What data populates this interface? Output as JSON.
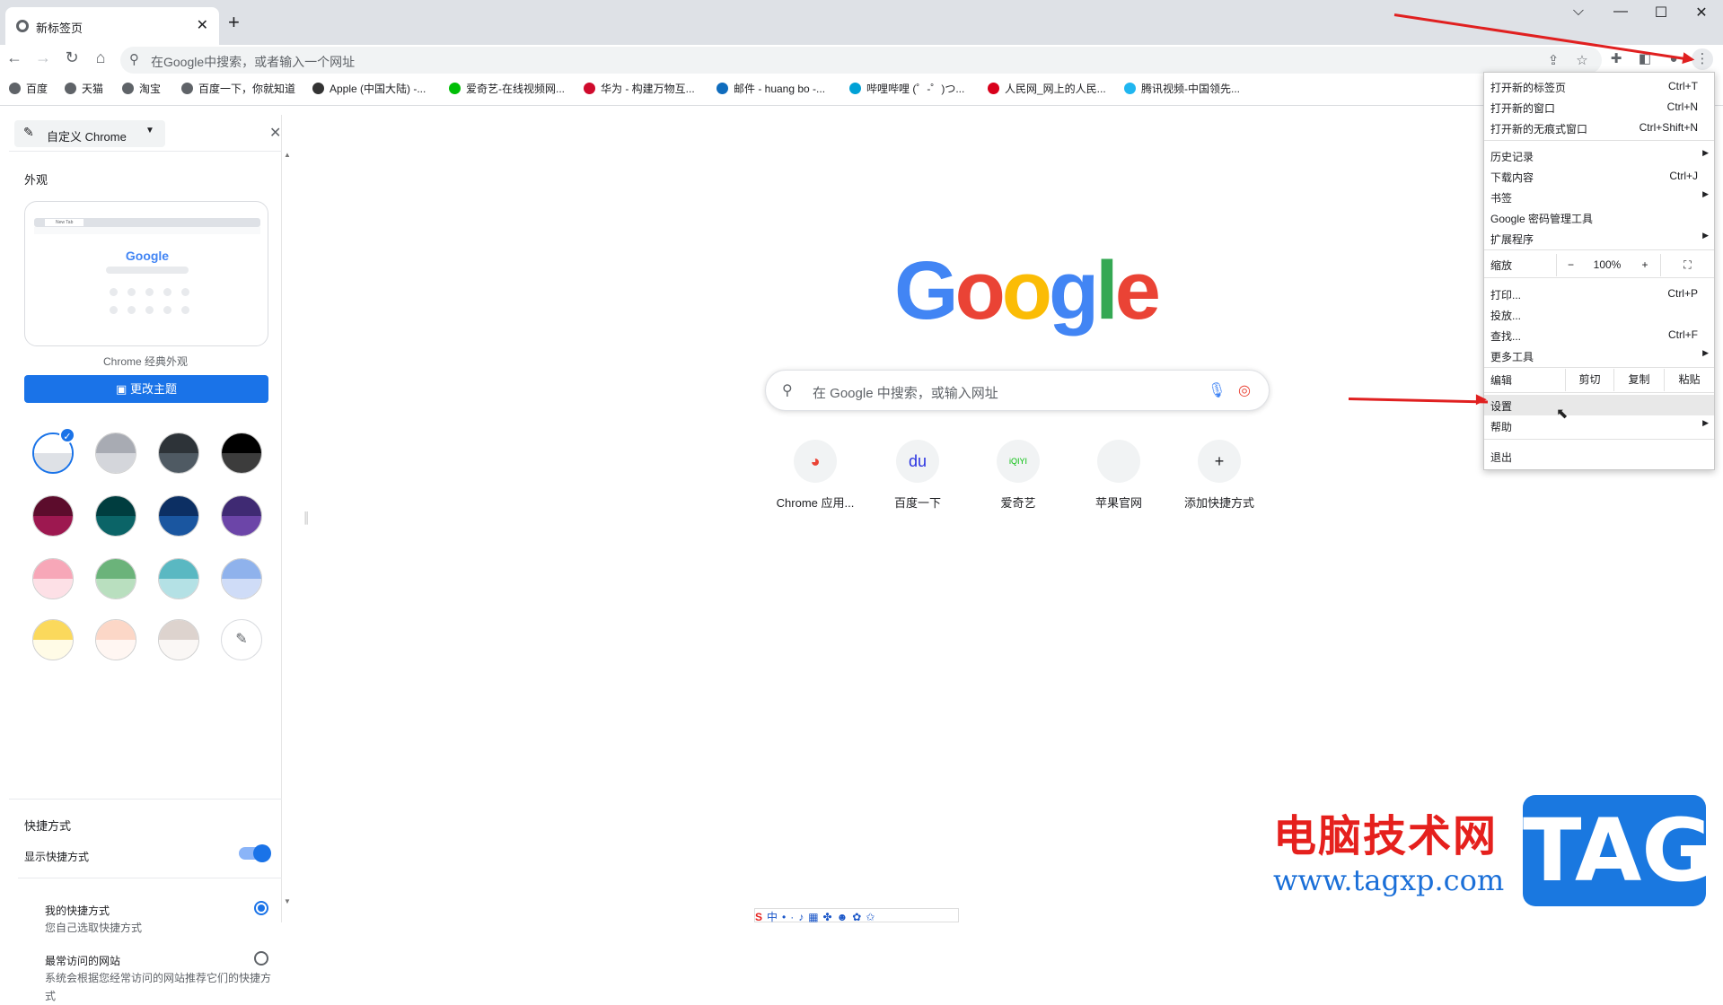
{
  "tab": {
    "title": "新标签页",
    "close": "✕",
    "new": "+"
  },
  "window": {
    "chevron": "⌵",
    "minimize": "—",
    "maximize": "☐",
    "close": "✕"
  },
  "nav": {
    "back": "←",
    "forward": "→",
    "reload": "↻",
    "home": "⌂"
  },
  "omnibox": {
    "placeholder": "在Google中搜索，或者输入一个网址",
    "search_icon": "search-icon"
  },
  "bookmarks": [
    {
      "label": "百度",
      "color": "#5f6368"
    },
    {
      "label": "天猫",
      "color": "#5f6368"
    },
    {
      "label": "淘宝",
      "color": "#5f6368"
    },
    {
      "label": "百度一下，你就知道",
      "color": "#5f6368"
    },
    {
      "label": "Apple (中国大陆) -...",
      "color": "#333333"
    },
    {
      "label": "爱奇艺-在线视频网...",
      "color": "#00be06"
    },
    {
      "label": "华为 - 构建万物互...",
      "color": "#cf0a2c"
    },
    {
      "label": "邮件 - huang bo -...",
      "color": "#0f6cbd"
    },
    {
      "label": "哔哩哔哩 (゜-゜)つ...",
      "color": "#00a1d6"
    },
    {
      "label": "人民网_网上的人民...",
      "color": "#d8001b"
    },
    {
      "label": "腾讯视频-中国领先...",
      "color": "#20b6f0"
    }
  ],
  "panel": {
    "header": "自定义 Chrome",
    "appearance": "外观",
    "preview_logo": "Google",
    "preview_tab": "New Tab",
    "preview_caption": "Chrome 经典外观",
    "change_theme": "更改主题",
    "shortcuts_title": "快捷方式",
    "show_shortcuts": "显示快捷方式",
    "show_shortcuts_on": true,
    "my_shortcuts": "我的快捷方式",
    "my_shortcuts_desc": "您自己选取快捷方式",
    "most_visited": "最常访问的网站",
    "most_visited_desc": "系统会根据您经常访问的网站推荐它们的快捷方式",
    "selected_option": "my_shortcuts"
  },
  "swatches": [
    {
      "top": "#ffffff",
      "bottom": "#dee1e6",
      "selected": true
    },
    {
      "top": "#a8abb3",
      "bottom": "#d4d6db"
    },
    {
      "top": "#2d3338",
      "bottom": "#4f5a63"
    },
    {
      "top": "#000000",
      "bottom": "#3c3c3c"
    },
    {
      "top": "#5c0c2c",
      "bottom": "#9d1850"
    },
    {
      "top": "#003d3f",
      "bottom": "#0b6467"
    },
    {
      "top": "#0c2f63",
      "bottom": "#1a56a0"
    },
    {
      "top": "#3f2a73",
      "bottom": "#6c45a8"
    },
    {
      "top": "#f7a7b8",
      "bottom": "#fde0e6"
    },
    {
      "top": "#6bb37a",
      "bottom": "#b9dfbf"
    },
    {
      "top": "#5ab8c2",
      "bottom": "#b4e1e5"
    },
    {
      "top": "#8fb2ec",
      "bottom": "#cfdcf7"
    },
    {
      "top": "#fbd95c",
      "bottom": "#fffbe6"
    },
    {
      "top": "#fcd7c7",
      "bottom": "#fff6f2"
    },
    {
      "top": "#ddd3ce",
      "bottom": "#faf7f5"
    }
  ],
  "ntp": {
    "logo": [
      "G",
      "o",
      "o",
      "g",
      "l",
      "e"
    ],
    "logo_colors": [
      "#4285f4",
      "#ea4335",
      "#fbbc05",
      "#4285f4",
      "#34a853",
      "#ea4335"
    ],
    "search_placeholder": "在 Google 中搜索，或输入网址",
    "shortcuts": [
      {
        "label": "Chrome 应用...",
        "glyph": "◕",
        "color": "#ea4335"
      },
      {
        "label": "百度一下",
        "glyph": "du",
        "color": "#2932e1"
      },
      {
        "label": "爱奇艺",
        "glyph": "iQIYI",
        "color": "#00be06"
      },
      {
        "label": "苹果官网",
        "glyph": "",
        "color": "#202124"
      },
      {
        "label": "添加快捷方式",
        "glyph": "+",
        "color": "#202124"
      }
    ]
  },
  "menu": {
    "items": [
      {
        "label": "打开新的标签页",
        "key": "Ctrl+T"
      },
      {
        "label": "打开新的窗口",
        "key": "Ctrl+N"
      },
      {
        "label": "打开新的无痕式窗口",
        "key": "Ctrl+Shift+N"
      },
      {
        "label": "历史记录",
        "submenu": true
      },
      {
        "label": "下载内容",
        "key": "Ctrl+J"
      },
      {
        "label": "书签",
        "submenu": true
      },
      {
        "label": "Google 密码管理工具"
      },
      {
        "label": "扩展程序",
        "submenu": true
      },
      {
        "label": "打印...",
        "key": "Ctrl+P"
      },
      {
        "label": "投放..."
      },
      {
        "label": "查找...",
        "key": "Ctrl+F"
      },
      {
        "label": "更多工具",
        "submenu": true
      },
      {
        "label": "设置",
        "highlighted": true
      },
      {
        "label": "帮助",
        "submenu": true
      },
      {
        "label": "退出"
      }
    ],
    "zoom": {
      "label": "缩放",
      "minus": "−",
      "value": "100%",
      "plus": "+",
      "fullscreen": "⛶"
    },
    "edit": {
      "label": "编辑",
      "cut": "剪切",
      "copy": "复制",
      "paste": "粘贴"
    }
  },
  "watermark": {
    "text": "电脑技术网",
    "url": "www.tagxp.com",
    "tag": "TAG"
  },
  "colors": {
    "accent": "#1a73e8",
    "annotation": "#e02020"
  }
}
